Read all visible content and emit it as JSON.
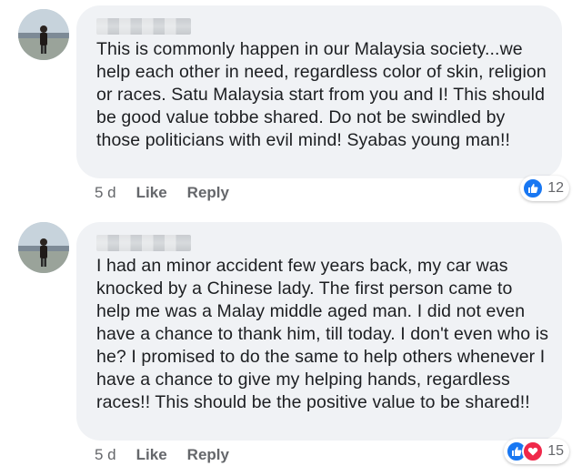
{
  "comments": [
    {
      "text": "This is commonly happen in our Malaysia society...we help each other in need, regardless color of skin, religion or races. Satu Malaysia start from you and I! This should be good value tobbe shared. Do not be swindled by those politicians with evil mind!  Syabas young man!!",
      "time": "5 d",
      "like_label": "Like",
      "reply_label": "Reply",
      "reactions": [
        "like-icon"
      ],
      "reaction_count": "12"
    },
    {
      "text": "I had an minor accident few years back, my car was knocked by a Chinese lady. The first person came to help me was a Malay middle aged man. I did not even have a chance to thank him, till today. I don't even who is he? I promised to do the same to help others whenever I have a chance to give my helping hands, regardless races!! This should be the positive value to be shared!!",
      "time": "5 d",
      "like_label": "Like",
      "reply_label": "Reply",
      "reactions": [
        "like-icon",
        "love-icon"
      ],
      "reaction_count": "15"
    }
  ],
  "colors": {
    "bubble": "#f0f2f5",
    "like": "#1877f2",
    "love": "#f0284a",
    "meta": "#65676b"
  }
}
